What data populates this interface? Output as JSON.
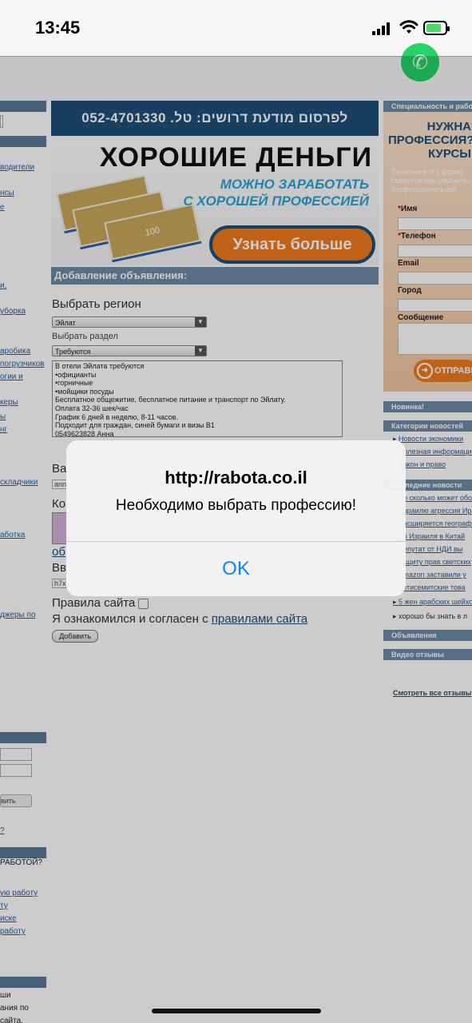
{
  "status_bar": {
    "time": "13:45"
  },
  "page": {
    "phone_banner": "לפרסום מודעת דרושים: טל. 052-4701330",
    "ad": {
      "headline": "ХОРОШИЕ ДЕНЬГИ",
      "sub1": "МОЖНО ЗАРАБОТАТЬ",
      "sub2": "С ХОРОШЕЙ ПРОФЕССИЕЙ",
      "button": "Узнать больше",
      "money_label": "100"
    },
    "form": {
      "section_title": "Добавление объявления:",
      "region_label": "Выбрать регион",
      "region_value": "Эйлат",
      "section_label": "Выбрать раздел",
      "section_value": "Требуются",
      "ad_text": "В отели Эйлата требуются\n•официанты\n•горничные\n•мойщики посуды\nБесплатное общежитие, бесплатное питание и транспорт по Эйлату.\nОплата 32-36 шек/час\nГрафик 6 дней в неделю, 8-11 часов.\nПодходит для граждан, синей бумаги и визы В1\n0549623828 Анна",
      "partial_1": "Ва",
      "partial_1_input": "ann",
      "partial_2": "Ко",
      "partial_3": "об",
      "partial_4": "Вв",
      "partial_4_input": "h7x",
      "rules_label": "Правила сайта",
      "agree_text": "Я ознакомился и согласен с ",
      "agree_link": "правилами сайта",
      "submit": "Добавить"
    },
    "left_col": {
      "links": [
        "водители",
        "нсы",
        "е",
        "и,",
        "уборка",
        "аробика",
        "погрузчиков",
        "огии и",
        "керы",
        "ы",
        "нг",
        "складчики",
        "аботка",
        "джеры по"
      ],
      "input_button": "вить",
      "question": "?",
      "heading": "РАБОТОЙ?",
      "links2": [
        "ую работу",
        "ту",
        "иске",
        "работу"
      ],
      "footer": [
        "ши",
        "ания по",
        "сайта."
      ]
    },
    "right_col": {
      "top_header": "Специальность и работа",
      "orange_title": "НУЖНА\nПРОФЕССИЯ?\nКУРСЫ",
      "orange_sub": "Заполните эту форму\nсвяжутся консультанты\nпрофессиональной",
      "fields": {
        "name": "Имя",
        "phone": "Телефон",
        "email": "Email",
        "city": "Город",
        "message": "Сообщение"
      },
      "send": "ОТПРАВИТЬ",
      "novinka": "Новинка!",
      "news_header": "Категории новостей",
      "news_cats": [
        "Новости экономики",
        "Полезная информация",
        "Закон и право"
      ],
      "latest_header": "Последние новости",
      "latest": [
        "Во сколько может обойтись",
        "Израилю агрессия Ирана",
        "Расширяется география",
        "Из Израиля в Китай",
        "Депутат от НДИ вы",
        "защиту прав светских",
        "Amazon заставили у",
        "антисемитские това",
        "5 жен арабских шейхов",
        "хорошо бы знать в л"
      ],
      "ads_header": "Объявления",
      "video_header": "Видео отзывы",
      "all_reviews": "Смотреть все отзывы"
    }
  },
  "alert": {
    "title": "http://rabota.co.il",
    "message": "Необходимо выбрать профессию!",
    "ok": "OK"
  }
}
